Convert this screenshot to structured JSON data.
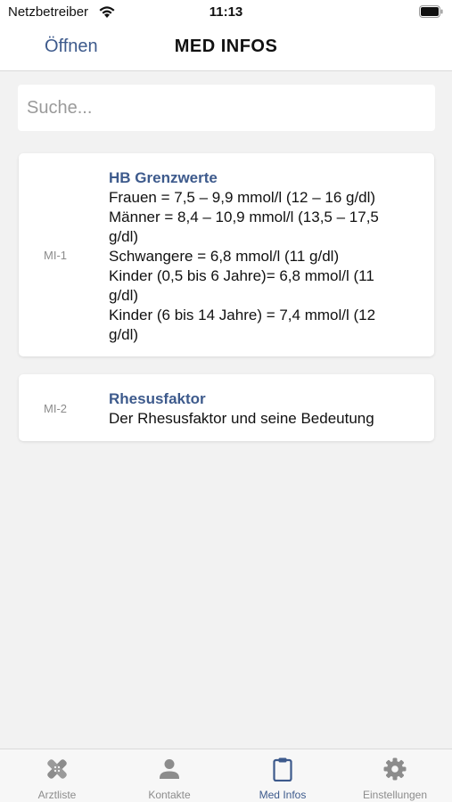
{
  "status_bar": {
    "carrier": "Netzbetreiber",
    "time": "11:13"
  },
  "nav": {
    "left_button": "Öffnen",
    "title": "MED INFOS"
  },
  "search": {
    "placeholder": "Suche...",
    "value": ""
  },
  "cards": [
    {
      "id": "MI-1",
      "title": "HB Grenzwerte",
      "lines": [
        "Frauen = 7,5 – 9,9 mmol/l (12 – 16 g/dl)",
        "Männer = 8,4 – 10,9 mmol/l (13,5 – 17,5",
        "g/dl)",
        "Schwangere = 6,8 mmol/l (11 g/dl)",
        "Kinder (0,5 bis 6 Jahre)= 6,8 mmol/l (11",
        "g/dl)",
        "Kinder (6 bis 14 Jahre) = 7,4 mmol/l (12",
        "g/dl)"
      ]
    },
    {
      "id": "MI-2",
      "title": "Rhesusfaktor",
      "lines": [
        "Der Rhesusfaktor und seine Bedeutung"
      ]
    }
  ],
  "tabs": [
    {
      "label": "Arztliste",
      "icon": "bandage-icon",
      "active": false
    },
    {
      "label": "Kontakte",
      "icon": "person-icon",
      "active": false
    },
    {
      "label": "Med Infos",
      "icon": "clipboard-icon",
      "active": true
    },
    {
      "label": "Einstellungen",
      "icon": "gear-icon",
      "active": false
    }
  ],
  "colors": {
    "accent": "#3d5a8c",
    "inactive": "#8c8c8c",
    "background": "#f2f2f2"
  }
}
